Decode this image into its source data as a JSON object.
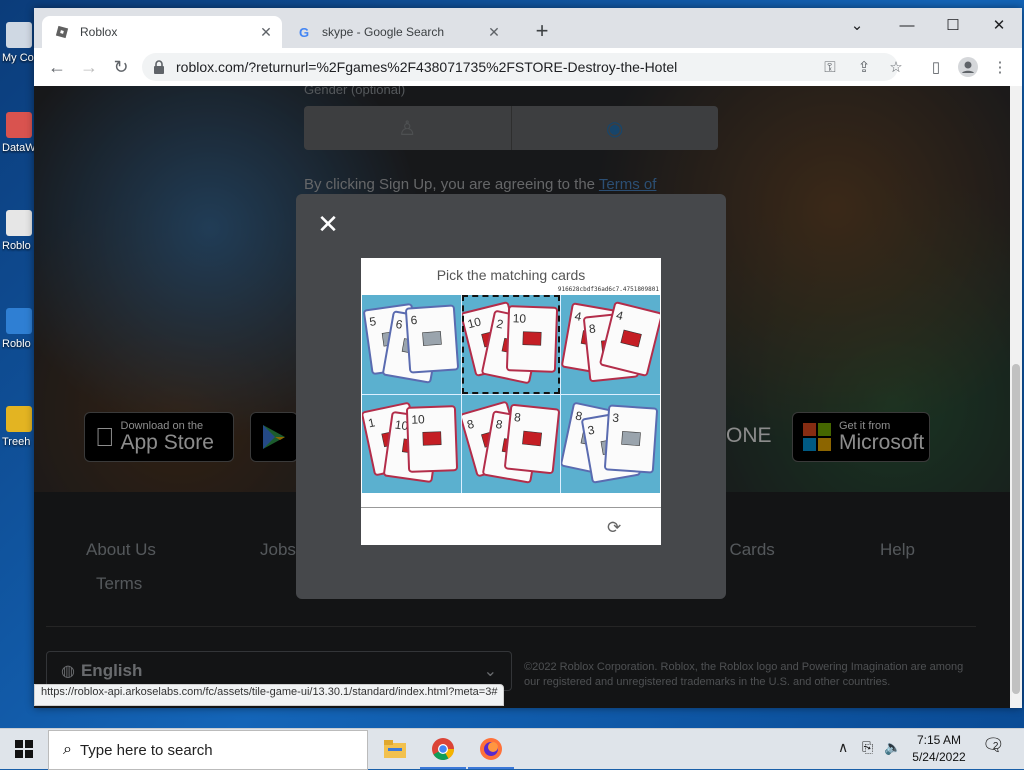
{
  "desktop": {
    "icons": [
      {
        "label": "My Co",
        "icon": "computer-icon"
      },
      {
        "label": "DataW",
        "icon": "app-shortcut-icon"
      },
      {
        "label": "Roblo",
        "icon": "roblox-shortcut-icon"
      },
      {
        "label": "Roblo",
        "icon": "roblox-shortcut-icon"
      },
      {
        "label": "Treeh",
        "icon": "folder-shortcut-icon"
      }
    ]
  },
  "browser": {
    "tabs": [
      {
        "title": "Roblox",
        "active": true,
        "favicon": "roblox-favicon-icon"
      },
      {
        "title": "skype - Google Search",
        "active": false,
        "favicon": "google-g-icon"
      }
    ],
    "new_tab_label": "+",
    "window_controls": {
      "minimize": "—",
      "maximize": "☐",
      "close": "✕"
    },
    "address": "roblox.com/?returnurl=%2Fgames%2F438071735%2FSTORE-Destroy-the-Hotel",
    "status_url": "https://roblox-api.arkoselabs.com/fc/assets/tile-game-ui/13.30.1/standard/index.html?meta=3#"
  },
  "page": {
    "gender_label": "Gender (optional)",
    "agree_text": "By clicking Sign Up, you are agreeing to the ",
    "terms_link": "Terms of",
    "store_buttons": {
      "appstore_small": "Download on the",
      "appstore_big": "App Store",
      "xbox_partial": "ONE",
      "microsoft_small": "Get it from",
      "microsoft_big": "Microsoft"
    },
    "footer_links": [
      "About Us",
      "Jobs",
      "t Cards",
      "Help",
      "Terms"
    ],
    "language": "English",
    "copyright": "©2022 Roblox Corporation. Roblox, the Roblox logo and Powering Imagination are among our registered and unregistered trademarks in the U.S. and other countries."
  },
  "captcha": {
    "prompt": "Pick the matching cards",
    "session_hash": "916628cbdf36ad6c7.4751809801",
    "tiles": [
      {
        "cards": [
          "5",
          "6",
          "6"
        ],
        "symbol": "envelope-gray",
        "selected": false
      },
      {
        "cards": [
          "10",
          "2",
          "10"
        ],
        "symbol": "envelope-red",
        "selected": true
      },
      {
        "cards": [
          "4",
          "8",
          "4"
        ],
        "symbol": "envelope-red",
        "selected": false
      },
      {
        "cards": [
          "1",
          "10",
          "10"
        ],
        "symbol": "bag-red",
        "selected": false
      },
      {
        "cards": [
          "8",
          "8",
          "8"
        ],
        "symbol": "bag-red",
        "selected": false
      },
      {
        "cards": [
          "8",
          "3",
          "3"
        ],
        "symbol": "envelope-gray",
        "selected": false
      }
    ],
    "refresh_icon": "refresh-icon"
  },
  "taskbar": {
    "search_placeholder": "Type here to search",
    "apps": [
      "file-explorer-icon",
      "chrome-icon",
      "firefox-icon"
    ],
    "time": "7:15 AM",
    "date": "5/24/2022",
    "notification_count": "2"
  }
}
